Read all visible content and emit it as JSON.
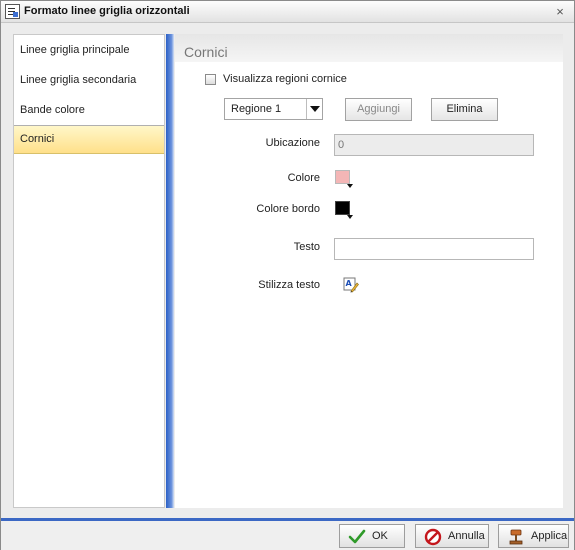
{
  "window": {
    "title": "Formato linee griglia orizzontali",
    "close": "×"
  },
  "nav": {
    "items": [
      {
        "label": "Linee griglia principale"
      },
      {
        "label": "Linee griglia secondaria"
      },
      {
        "label": "Bande colore"
      },
      {
        "label": "Cornici"
      }
    ],
    "active_index": 3
  },
  "panel": {
    "title": "Cornici",
    "show_regions": {
      "label": "Visualizza regioni cornice",
      "checked": false
    },
    "region_select": {
      "value": "Regione 1"
    },
    "add_button": {
      "label": "Aggiungi",
      "disabled": true
    },
    "delete_button": {
      "label": "Elimina",
      "disabled": false
    },
    "location": {
      "label": "Ubicazione",
      "value": "0",
      "disabled": true
    },
    "color": {
      "label": "Colore",
      "color": "#f4b6b6"
    },
    "border_color": {
      "label": "Colore bordo",
      "color": "#000000"
    },
    "text": {
      "label": "Testo",
      "value": ""
    },
    "style_text": {
      "label": "Stilizza testo",
      "icon": "text-style-icon"
    }
  },
  "footer": {
    "ok": {
      "label": "OK",
      "icon": "check-icon"
    },
    "cancel": {
      "label": "Annulla",
      "icon": "cancel-icon"
    },
    "apply": {
      "label": "Applica",
      "icon": "apply-icon"
    }
  },
  "colors": {
    "accent": "#3b68c4",
    "active_nav": "#ffe08a"
  }
}
